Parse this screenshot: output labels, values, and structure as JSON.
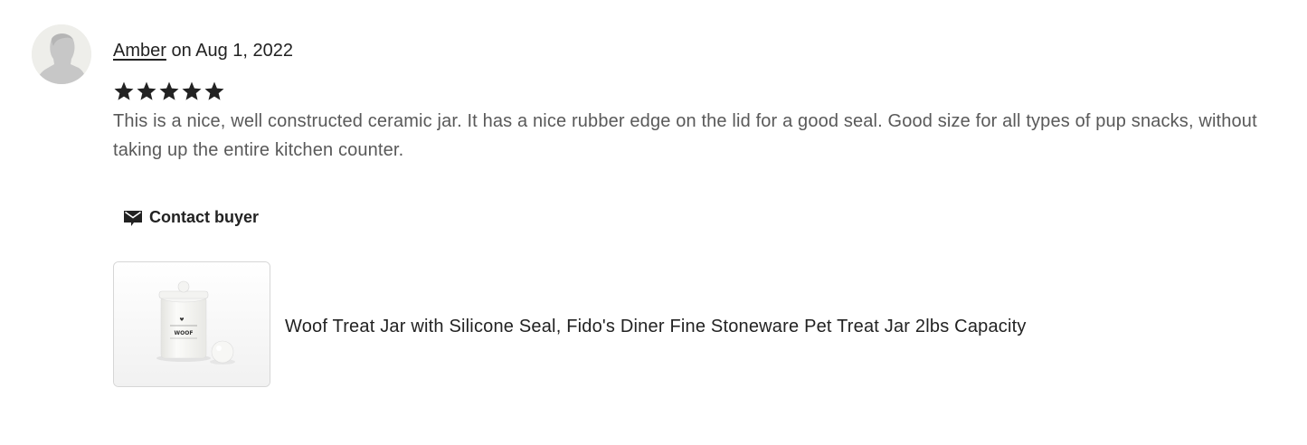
{
  "review": {
    "reviewer_name": "Amber",
    "date_text": " on Aug 1, 2022",
    "rating": 5,
    "rating_max": 5,
    "text": "This is a nice, well constructed ceramic jar. It has a nice rubber edge on the lid for a good seal. Good size for all types of pup snacks, without taking up the entire kitchen counter."
  },
  "actions": {
    "contact_label": "Contact buyer",
    "contact_icon": "envelope-icon"
  },
  "product": {
    "title": "Woof Treat Jar with Silicone Seal, Fido's Diner Fine Stoneware Pet Treat Jar 2lbs Capacity",
    "jar_label": "WOOF"
  },
  "colors": {
    "star": "#222222",
    "text_muted": "#595959",
    "avatar_bg": "#eeeeea",
    "avatar_figure": "#c7c7c7"
  }
}
